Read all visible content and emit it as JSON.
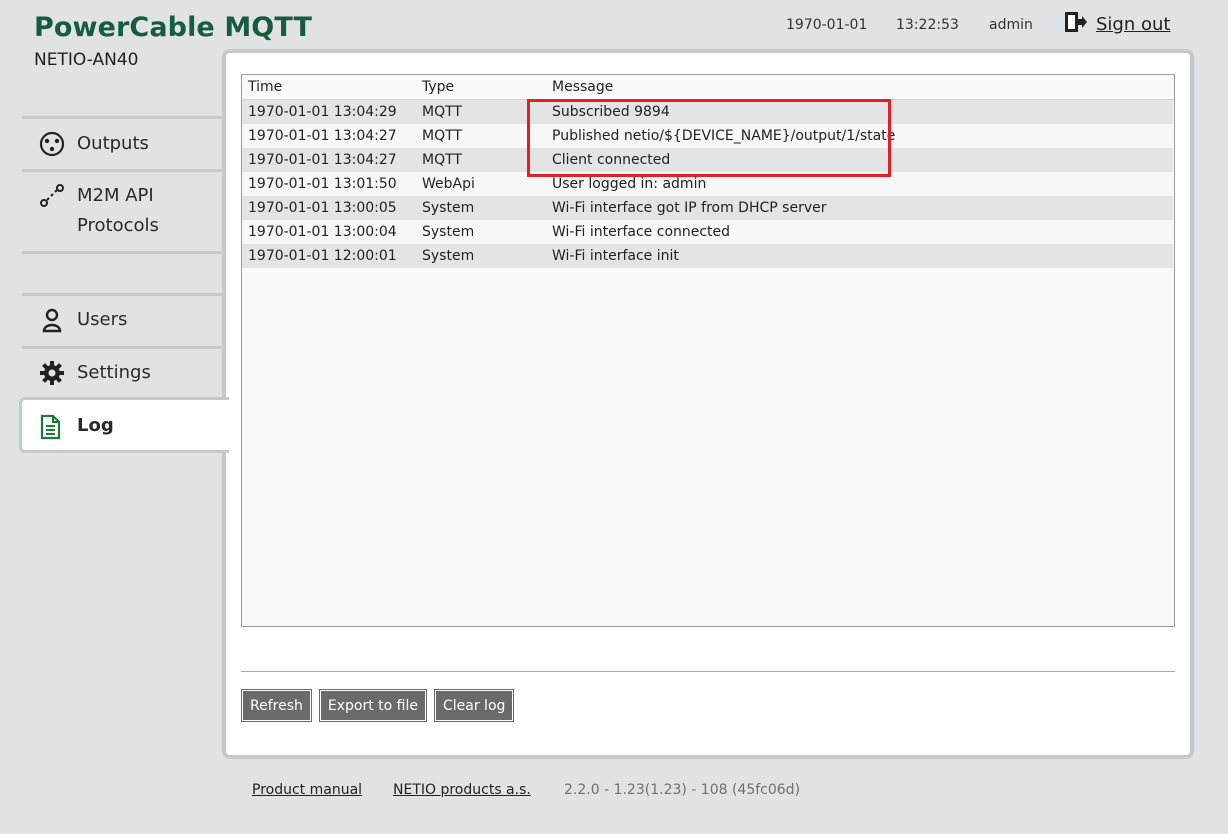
{
  "header": {
    "app_title": "PowerCable MQTT",
    "device_model": "NETIO-AN40",
    "date": "1970-01-01",
    "time": "13:22:53",
    "user": "admin",
    "signout_label": "Sign out",
    "signout_icon": "sign-out-icon"
  },
  "sidebar": {
    "items": [
      {
        "label": "Outputs",
        "icon": "outputs-socket-icon"
      },
      {
        "label_line1": "M2M API",
        "label_line2": "Protocols",
        "icon": "m2m-protocols-icon"
      },
      {
        "label": "Users",
        "icon": "user-icon"
      },
      {
        "label": "Settings",
        "icon": "gear-icon"
      },
      {
        "label": "Log",
        "icon": "document-icon",
        "active": true
      }
    ]
  },
  "log": {
    "columns": [
      "Time",
      "Type",
      "Message"
    ],
    "rows": [
      {
        "time": "1970-01-01 13:04:29",
        "type": "MQTT",
        "message": "Subscribed 9894"
      },
      {
        "time": "1970-01-01 13:04:27",
        "type": "MQTT",
        "message": "Published netio/${DEVICE_NAME}/output/1/state"
      },
      {
        "time": "1970-01-01 13:04:27",
        "type": "MQTT",
        "message": "Client connected"
      },
      {
        "time": "1970-01-01 13:01:50",
        "type": "WebApi",
        "message": "User logged in: admin"
      },
      {
        "time": "1970-01-01 13:00:05",
        "type": "System",
        "message": "Wi-Fi interface got IP from DHCP server"
      },
      {
        "time": "1970-01-01 13:00:04",
        "type": "System",
        "message": "Wi-Fi interface connected"
      },
      {
        "time": "1970-01-01 12:00:01",
        "type": "System",
        "message": "Wi-Fi interface init"
      }
    ],
    "highlight_color": "#e01f26"
  },
  "buttons": {
    "refresh": "Refresh",
    "export": "Export to file",
    "clear": "Clear log"
  },
  "footer": {
    "manual": "Product manual",
    "company": "NETIO products a.s.",
    "version": "2.2.0 - 1.23(1.23) - 108 (45fc06d)"
  },
  "colors": {
    "brand_green": "#165c3e",
    "background": "#e1e2e3",
    "button": "#6a6a6a"
  }
}
